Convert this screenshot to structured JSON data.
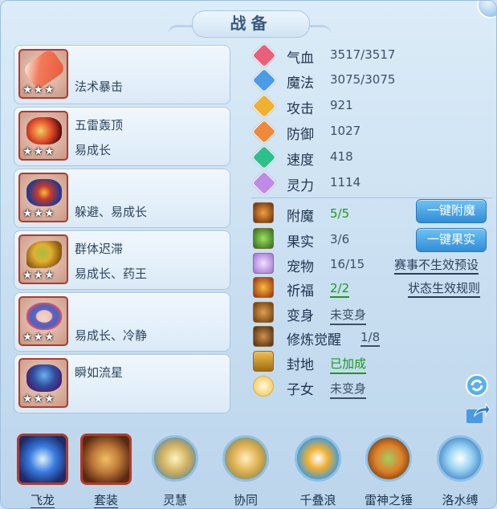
{
  "title": "战备",
  "cards": [
    {
      "line1": "",
      "line2": "法术暴击",
      "stars": "★★★",
      "art": "popsicle-icon",
      "color": "#e85a3a"
    },
    {
      "line1": "五雷轰顶",
      "line2": "易成长",
      "stars": "★★★",
      "art": "rainbow-shell-icon",
      "color": "#b02418"
    },
    {
      "line1": "",
      "line2": "躲避、易成长",
      "stars": "★★★",
      "art": "demon-mask-icon",
      "color": "#3b5db8"
    },
    {
      "line1": "群体迟滞",
      "line2": "易成长、药王",
      "stars": "★★★",
      "art": "golden-snake-icon",
      "color": "#c98a1a"
    },
    {
      "line1": "",
      "line2": "易成长、冷静",
      "stars": "★★★",
      "art": "jeweled-ring-icon",
      "color": "#6a4aa8"
    },
    {
      "line1": "瞬如流星",
      "line2": "",
      "stars": "★★★",
      "art": "armored-warrior-icon",
      "color": "#2f4fa0"
    }
  ],
  "stats": [
    {
      "label": "气血",
      "value": "3517/3517",
      "icon": "heart-icon",
      "color": "#e8607a"
    },
    {
      "label": "魔法",
      "value": "3075/3075",
      "icon": "mana-drop-icon",
      "color": "#4a9be8"
    },
    {
      "label": "攻击",
      "value": "921",
      "icon": "sword-icon",
      "color": "#f0b030"
    },
    {
      "label": "防御",
      "value": "1027",
      "icon": "shield-icon",
      "color": "#f08a3a"
    },
    {
      "label": "速度",
      "value": "418",
      "icon": "speed-bolt-icon",
      "color": "#2ec08a"
    },
    {
      "label": "灵力",
      "value": "1114",
      "icon": "spirit-star-icon",
      "color": "#c08ae8"
    }
  ],
  "extras": [
    {
      "label": "附魔",
      "value": "5/5",
      "green": true,
      "underline": false,
      "icon": "enchant-icon",
      "color": "#9a4a1a"
    },
    {
      "label": "果实",
      "value": "3/6",
      "green": false,
      "underline": false,
      "icon": "fruit-icon",
      "color": "#4a8a2a"
    },
    {
      "label": "宠物",
      "value": "16/15",
      "green": false,
      "underline": false,
      "icon": "pet-avatar-icon",
      "color": "#c8a0e8"
    },
    {
      "label": "祈福",
      "value": "2/2",
      "green": true,
      "underline": true,
      "icon": "blessing-icon",
      "color": "#c0501a"
    },
    {
      "label": "变身",
      "value": "未变身",
      "green": false,
      "underline": true,
      "icon": "transform-icon",
      "color": "#9a6a2a"
    },
    {
      "label": "修炼觉醒",
      "value": "1/8",
      "green": false,
      "underline": true,
      "icon": "cultivation-icon",
      "color": "#7a4a1a"
    },
    {
      "label": "封地",
      "value": "已加成",
      "green": true,
      "underline": true,
      "icon": "fief-gate-icon",
      "color": "#c8922a"
    },
    {
      "label": "子女",
      "value": "未变身",
      "green": false,
      "underline": true,
      "icon": "child-sun-icon",
      "color": "#f0c85a"
    }
  ],
  "buttons": {
    "enchant_all": "一键附魔",
    "fruit_all": "一键果实"
  },
  "links": {
    "event_preset": "赛事不生效预设",
    "status_rules": "状态生效规则"
  },
  "tabs": [
    {
      "label": "飞龙",
      "icon": "flying-dragon-icon",
      "style": "square",
      "active": true,
      "color": "#3a7ae0"
    },
    {
      "label": "套装",
      "icon": "suit-armor-icon",
      "style": "square",
      "active": false,
      "color": "#c07a3a"
    },
    {
      "label": "灵慧",
      "icon": "wisdom-icon",
      "style": "circle",
      "active": false,
      "color": "#e0c060"
    },
    {
      "label": "协同",
      "icon": "synergy-icon",
      "style": "circle",
      "active": false,
      "color": "#e0b050"
    },
    {
      "label": "千叠浪",
      "icon": "wave-icon",
      "style": "circle",
      "active": false,
      "color": "#3a9ae0"
    },
    {
      "label": "雷神之锤",
      "icon": "thunder-hammer-icon",
      "style": "circle",
      "active": false,
      "color": "#e0802a"
    },
    {
      "label": "洛水缚",
      "icon": "river-bind-icon",
      "style": "circle",
      "active": false,
      "color": "#5ab0e8"
    }
  ],
  "colors": {
    "frame_red": "#b33a2c",
    "green_value": "#1a9a1a",
    "button_blue": "#2f8ed8"
  }
}
